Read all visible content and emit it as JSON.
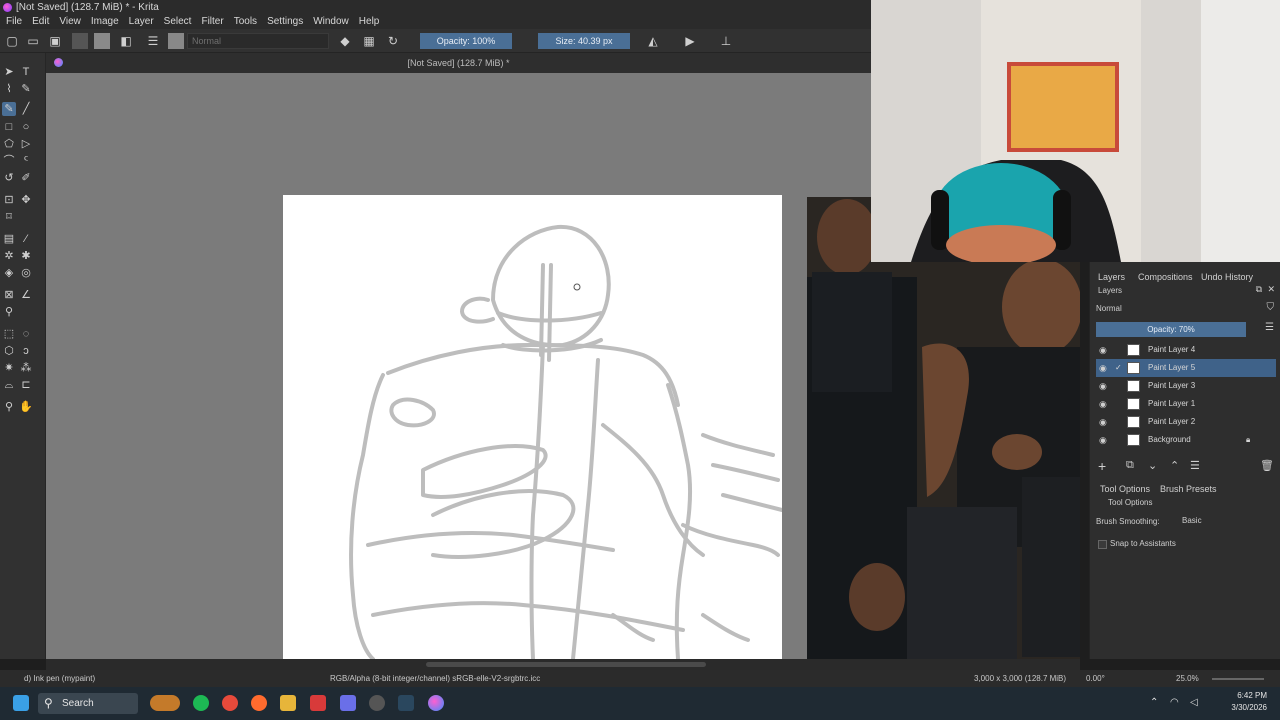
{
  "window": {
    "title": "[Not Saved]  (128.7 MiB) * - Krita"
  },
  "menu": [
    "File",
    "Edit",
    "View",
    "Image",
    "Layer",
    "Select",
    "Filter",
    "Tools",
    "Settings",
    "Window",
    "Help"
  ],
  "toolbar": {
    "blend_mode": "Normal",
    "opacity_label": "Opacity: 100%",
    "size_label": "Size: 40.39 px"
  },
  "document": {
    "tab_title": "[Not Saved]  (128.7 MiB) *"
  },
  "dock": {
    "tabs": [
      "Layers",
      "Compositions",
      "Undo History"
    ],
    "layers_title": "Layers",
    "blend_mode": "Normal",
    "opacity_label": "Opacity:  70%",
    "layers": [
      {
        "name": "Paint Layer 4",
        "selected": false
      },
      {
        "name": "Paint Layer 5",
        "selected": true
      },
      {
        "name": "Paint Layer 3",
        "selected": false
      },
      {
        "name": "Paint Layer 1",
        "selected": false
      },
      {
        "name": "Paint Layer 2",
        "selected": false
      },
      {
        "name": "Background",
        "selected": false
      }
    ],
    "lower_tabs": [
      "Tool Options",
      "Brush Presets"
    ],
    "tool_options_title": "Tool Options",
    "brush_smoothing_label": "Brush Smoothing:",
    "brush_smoothing_value": "Basic",
    "snap_label": "Snap to Assistants"
  },
  "status": {
    "brush": "d) Ink pen (mypaint)",
    "color_space": "RGB/Alpha (8-bit integer/channel)  sRGB-elle-V2-srgbtrc.icc",
    "dims": "3,000 x 3,000 (128.7 MiB)",
    "rotation": "0.00°",
    "zoom": "25.0%"
  },
  "taskbar": {
    "search_label": "Search",
    "time": "6:42 PM",
    "date": "3/30/2026"
  },
  "colors": {
    "accent": "#4a6f96",
    "bg": "#2e2e2e"
  }
}
